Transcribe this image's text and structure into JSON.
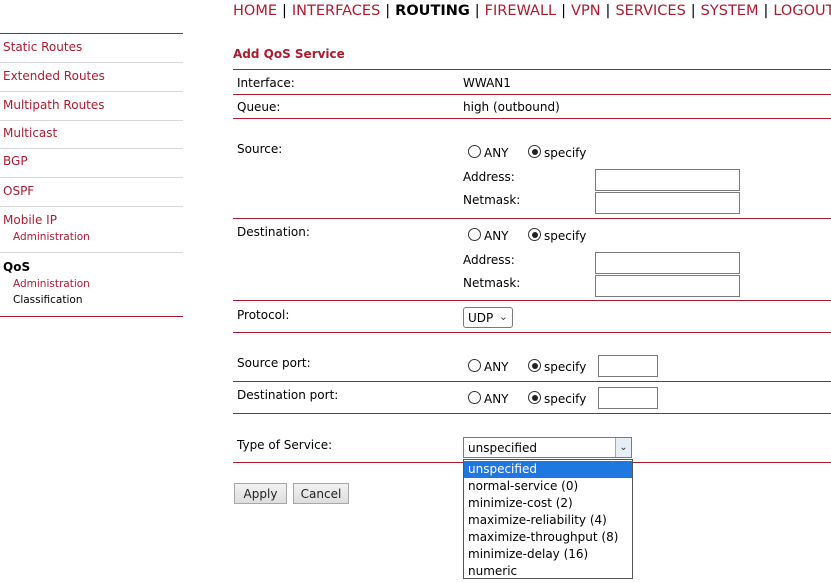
{
  "nav": {
    "items": [
      {
        "label": "HOME"
      },
      {
        "label": "INTERFACES"
      },
      {
        "label": "ROUTING",
        "active": true
      },
      {
        "label": "FIREWALL"
      },
      {
        "label": "VPN"
      },
      {
        "label": "SERVICES"
      },
      {
        "label": "SYSTEM"
      },
      {
        "label": "LOGOUT"
      }
    ],
    "separator": "|"
  },
  "sidebar": {
    "items": [
      {
        "label": "Static Routes"
      },
      {
        "label": "Extended Routes"
      },
      {
        "label": "Multipath Routes"
      },
      {
        "label": "Multicast"
      },
      {
        "label": "BGP"
      },
      {
        "label": "OSPF"
      },
      {
        "label": "Mobile IP",
        "sub": [
          "Administration"
        ]
      },
      {
        "label": "QoS",
        "sub": [
          "Administration",
          "Classification"
        ]
      }
    ]
  },
  "form": {
    "title": "Add QoS Service",
    "interface": {
      "label": "Interface:",
      "value": "WWAN1"
    },
    "queue": {
      "label": "Queue:",
      "value": "high (outbound)"
    },
    "source": {
      "label": "Source:",
      "any": "ANY",
      "specify": "specify",
      "selected": "specify",
      "address_label": "Address:",
      "address_value": "",
      "netmask_label": "Netmask:",
      "netmask_value": ""
    },
    "destination": {
      "label": "Destination:",
      "any": "ANY",
      "specify": "specify",
      "selected": "specify",
      "address_label": "Address:",
      "address_value": "",
      "netmask_label": "Netmask:",
      "netmask_value": ""
    },
    "protocol": {
      "label": "Protocol:",
      "value": "UDP"
    },
    "source_port": {
      "label": "Source port:",
      "any": "ANY",
      "specify": "specify",
      "selected": "specify",
      "value": ""
    },
    "destination_port": {
      "label": "Destination port:",
      "any": "ANY",
      "specify": "specify",
      "selected": "specify",
      "value": ""
    },
    "tos": {
      "label": "Type of Service:",
      "value": "unspecified",
      "options": [
        "unspecified",
        "normal-service (0)",
        "minimize-cost (2)",
        "maximize-reliability (4)",
        "maximize-throughput (8)",
        "minimize-delay (16)",
        "numeric"
      ],
      "highlighted_index": 0
    },
    "apply_label": "Apply",
    "cancel_label": "Cancel"
  },
  "colors": {
    "accent": "#b01a2e",
    "highlight": "#1e78e0"
  }
}
